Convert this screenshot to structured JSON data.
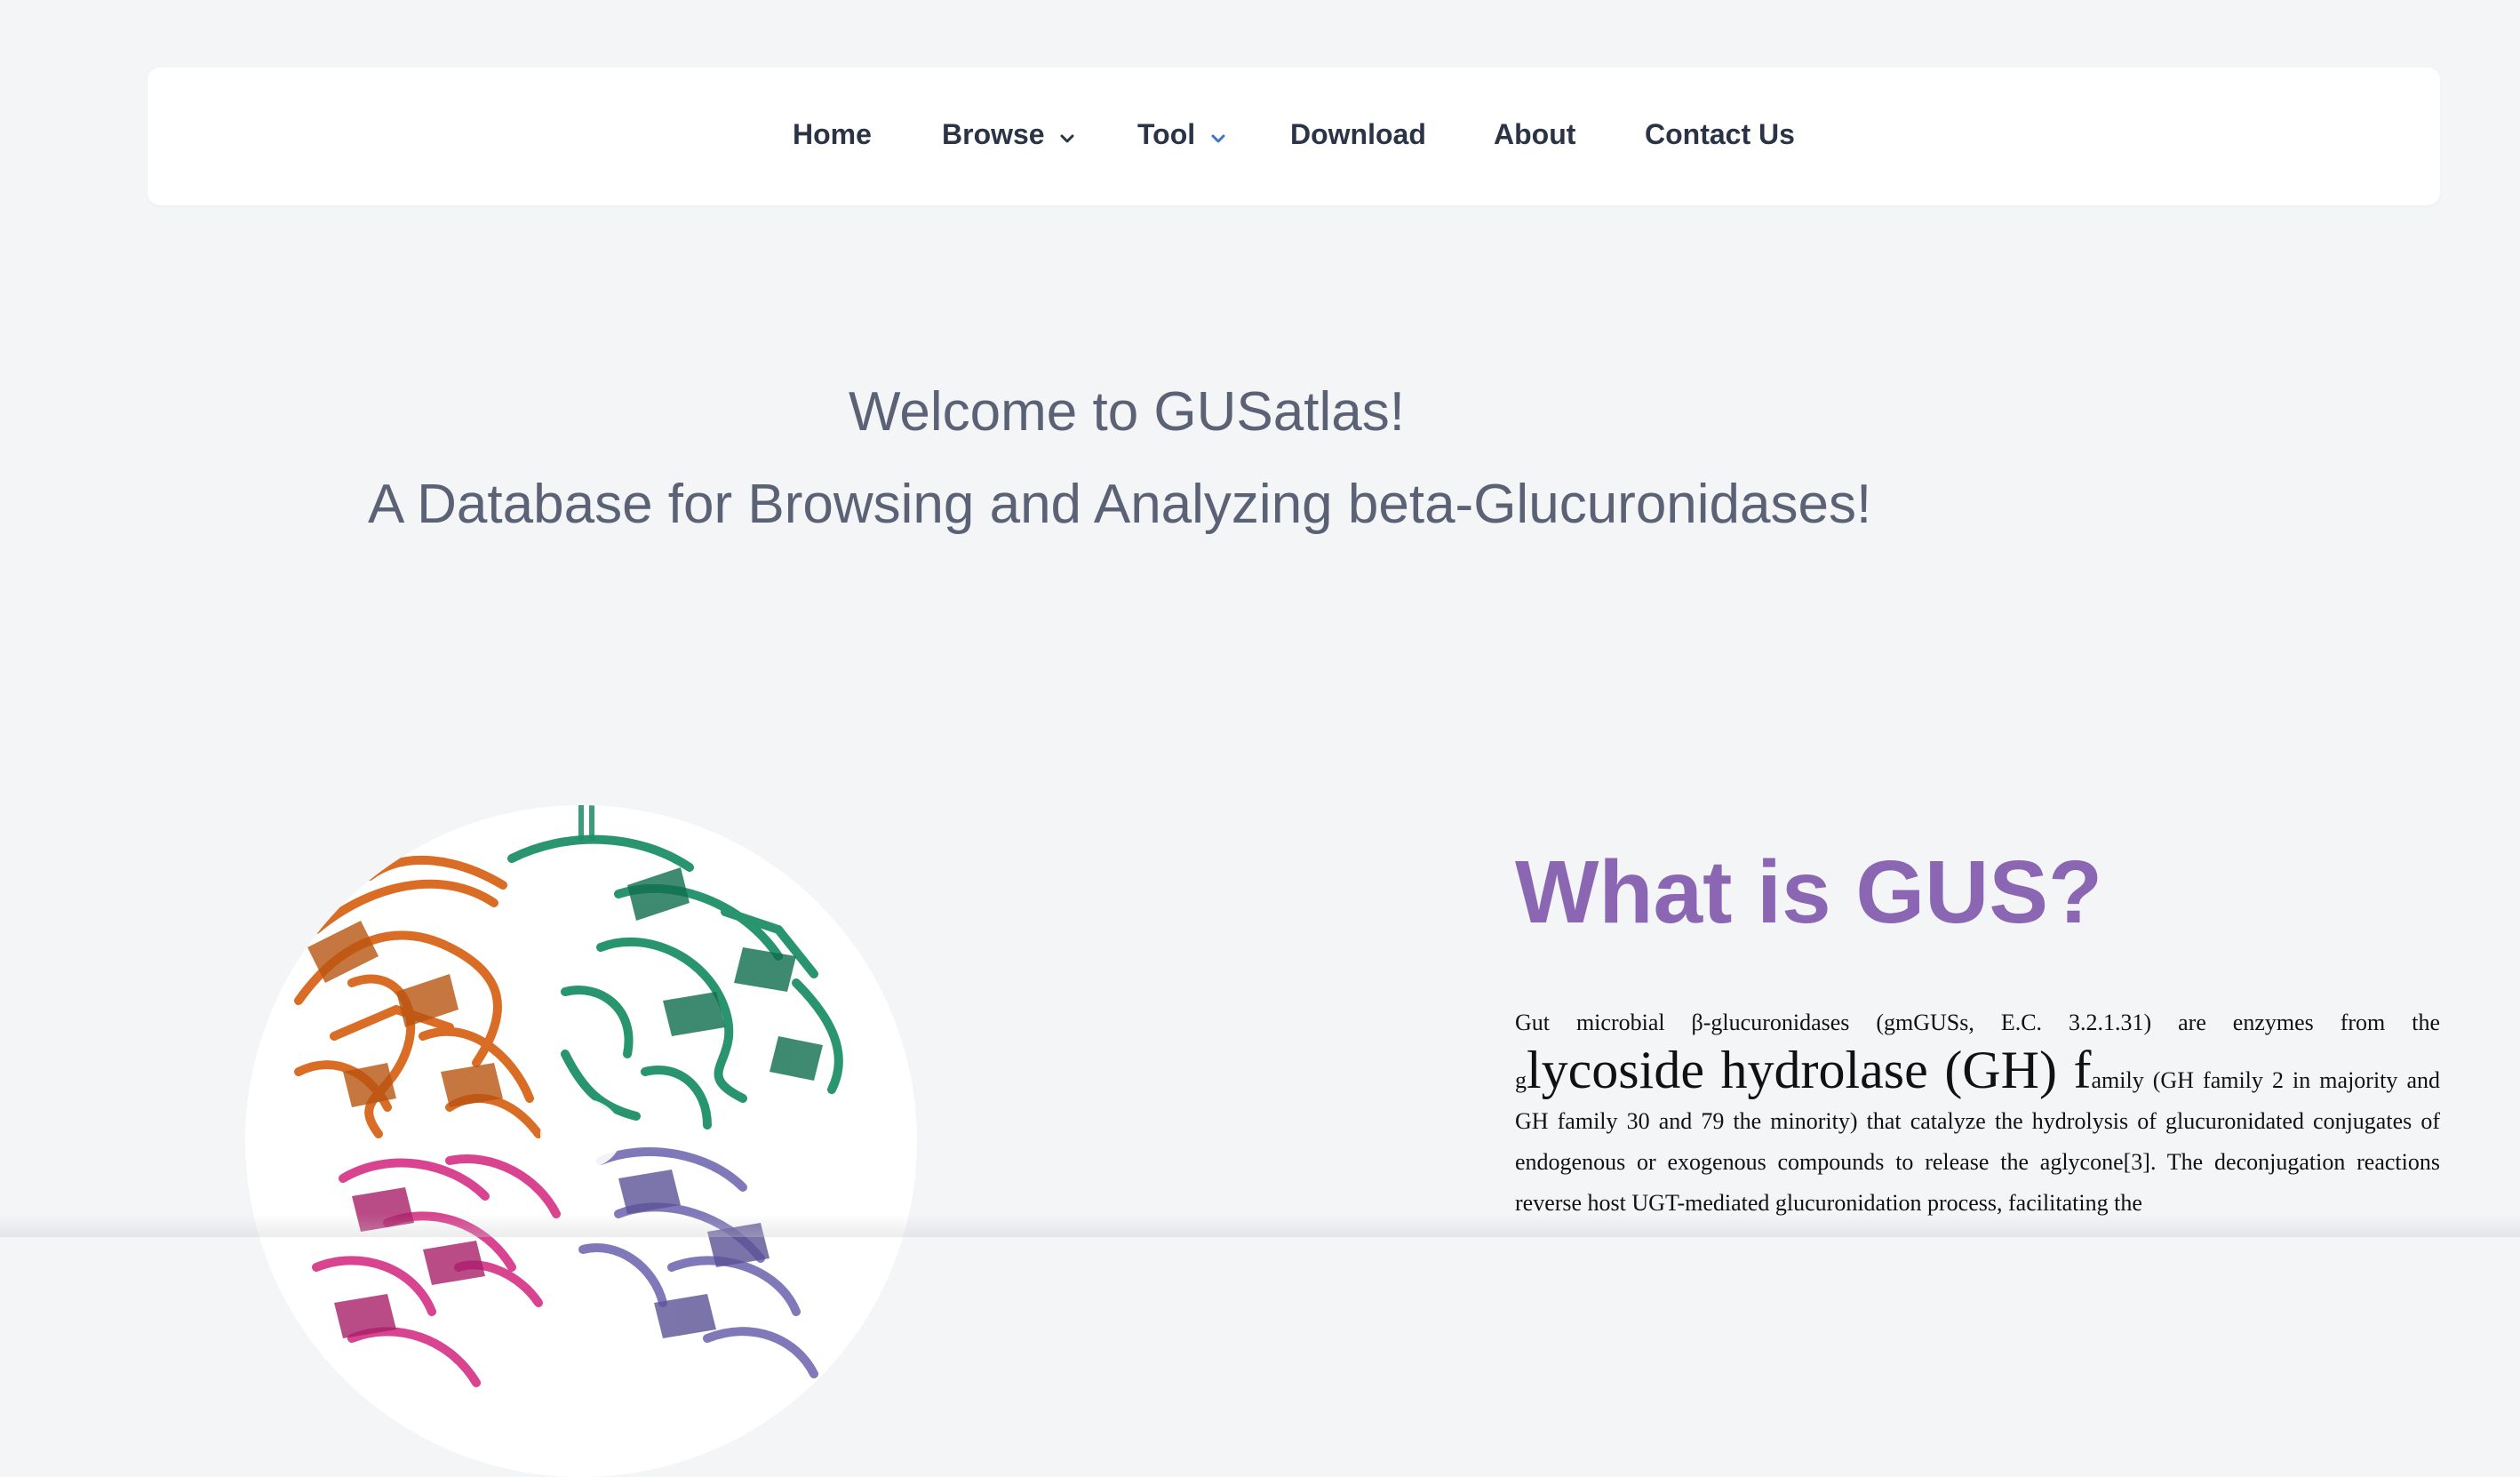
{
  "nav": {
    "items": [
      {
        "label": "Home"
      },
      {
        "label": "Browse",
        "has_dropdown": true
      },
      {
        "label": "Tool",
        "has_dropdown": true
      },
      {
        "label": "Download"
      },
      {
        "label": "About"
      },
      {
        "label": "Contact Us"
      }
    ],
    "dropdown_icon": "chevron-down-icon",
    "colors": {
      "text": "#2b3346",
      "tool_chevron": "#3f76c4"
    }
  },
  "hero": {
    "title": "Welcome to GUSatlas!",
    "subtitle": "A Database for Browsing and Analyzing beta-Glucuronidases!"
  },
  "intro": {
    "heading": "What is GUS?",
    "paragraph": {
      "part1": "Gut microbial β-glucuronidases (gmGUSs, E.C. 3.2.1.31) are enzymes from the ",
      "small_g": "g",
      "big_text": "lycoside hydrolase (GH) f",
      "part2": "amily (GH family 2 in majority and GH family 30 and 79 the minority) that catalyze the hydrolysis of glucuronidated conjugates of endogenous or exogenous compounds to release the aglycone[3]. The deconjugation reactions reverse host UGT-mediated glucuronidation process, facilitating the"
    },
    "image_alt": "protein-structure-image"
  },
  "colors": {
    "background": "#f4f5f7",
    "navbar_bg": "#ffffff",
    "hero_text": "#5b6275",
    "heading_purple": "#8b67b3"
  }
}
